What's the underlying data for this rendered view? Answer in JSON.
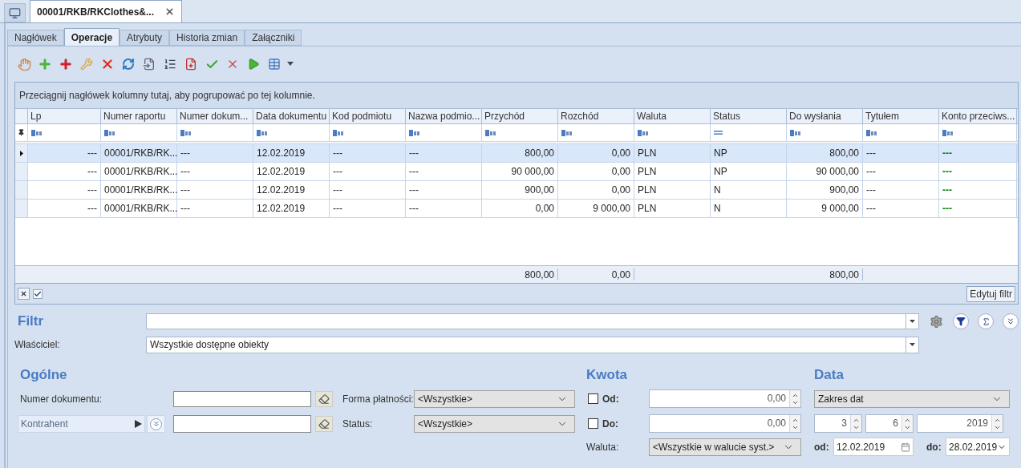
{
  "document_tab": {
    "title": "00001/RKB/RKClothes&..."
  },
  "tabs": [
    {
      "label": "Nagłówek",
      "selected": false
    },
    {
      "label": "Operacje",
      "selected": true
    },
    {
      "label": "Atrybuty",
      "selected": false
    },
    {
      "label": "Historia zmian",
      "selected": false
    },
    {
      "label": "Załączniki",
      "selected": false
    }
  ],
  "grid": {
    "group_hint": "Przeciągnij nagłówek kolumny tutaj, aby pogrupować po tej kolumnie.",
    "columns": [
      {
        "label": "Lp",
        "kind": "number"
      },
      {
        "label": "Numer raportu",
        "kind": "text"
      },
      {
        "label": "Numer dokum...",
        "kind": "text"
      },
      {
        "label": "Data dokumentu",
        "kind": "text"
      },
      {
        "label": "Kod podmiotu",
        "kind": "text"
      },
      {
        "label": "Nazwa podmio...",
        "kind": "text"
      },
      {
        "label": "Przychód",
        "kind": "number",
        "total": "800,00"
      },
      {
        "label": "Rozchód",
        "kind": "number",
        "total": "0,00"
      },
      {
        "label": "Waluta",
        "kind": "text"
      },
      {
        "label": "Status",
        "kind": "flag"
      },
      {
        "label": "Do wysłania",
        "kind": "number",
        "total": "800,00"
      },
      {
        "label": "Tytułem",
        "kind": "text"
      },
      {
        "label": "Konto przeciws...",
        "kind": "text",
        "color": "#008000"
      }
    ],
    "rows": [
      {
        "selected": true,
        "cells": [
          "---",
          "00001/RKB/RK...",
          "---",
          "12.02.2019",
          "---",
          "---",
          "800,00",
          "0,00",
          "PLN",
          "NP",
          "800,00",
          "---",
          "---"
        ]
      },
      {
        "selected": false,
        "cells": [
          "---",
          "00001/RKB/RK...",
          "---",
          "12.02.2019",
          "---",
          "---",
          "90 000,00",
          "0,00",
          "PLN",
          "NP",
          "90 000,00",
          "---",
          "---"
        ]
      },
      {
        "selected": false,
        "cells": [
          "---",
          "00001/RKB/RK...",
          "---",
          "12.02.2019",
          "---",
          "---",
          "900,00",
          "0,00",
          "PLN",
          "N",
          "900,00",
          "---",
          "---"
        ]
      },
      {
        "selected": false,
        "cells": [
          "---",
          "00001/RKB/RK...",
          "---",
          "12.02.2019",
          "---",
          "---",
          "0,00",
          "9 000,00",
          "PLN",
          "N",
          "9 000,00",
          "---",
          "---"
        ]
      }
    ],
    "filter_checked": true,
    "edit_filter_button": "Edytuj filtr"
  },
  "filter": {
    "label": "Filtr",
    "owner_label": "Właściciel:",
    "owner_value": "Wszystkie dostępne obiekty"
  },
  "general": {
    "heading": "Ogólne",
    "document_number_label": "Numer dokumentu:",
    "contractor_button": "Kontrahent",
    "payment_label": "Forma płatności:",
    "payment_value": "<Wszystkie>",
    "status_label": "Status:",
    "status_value": "<Wszystkie>"
  },
  "amount": {
    "heading": "Kwota",
    "from": {
      "label": "Od:",
      "checked": false,
      "value": "0,00"
    },
    "to": {
      "label": "Do:",
      "checked": false,
      "value": "0,00"
    },
    "currency_label": "Waluta:",
    "currency_value": "<Wszystkie w walucie syst.>"
  },
  "date": {
    "heading": "Data",
    "mode": "Zakres dat",
    "spins": [
      "3",
      "6",
      "2019"
    ],
    "from_label": "od:",
    "from_value": "12.02.2019",
    "to_label": "do:",
    "to_value": "28.02.2019"
  }
}
